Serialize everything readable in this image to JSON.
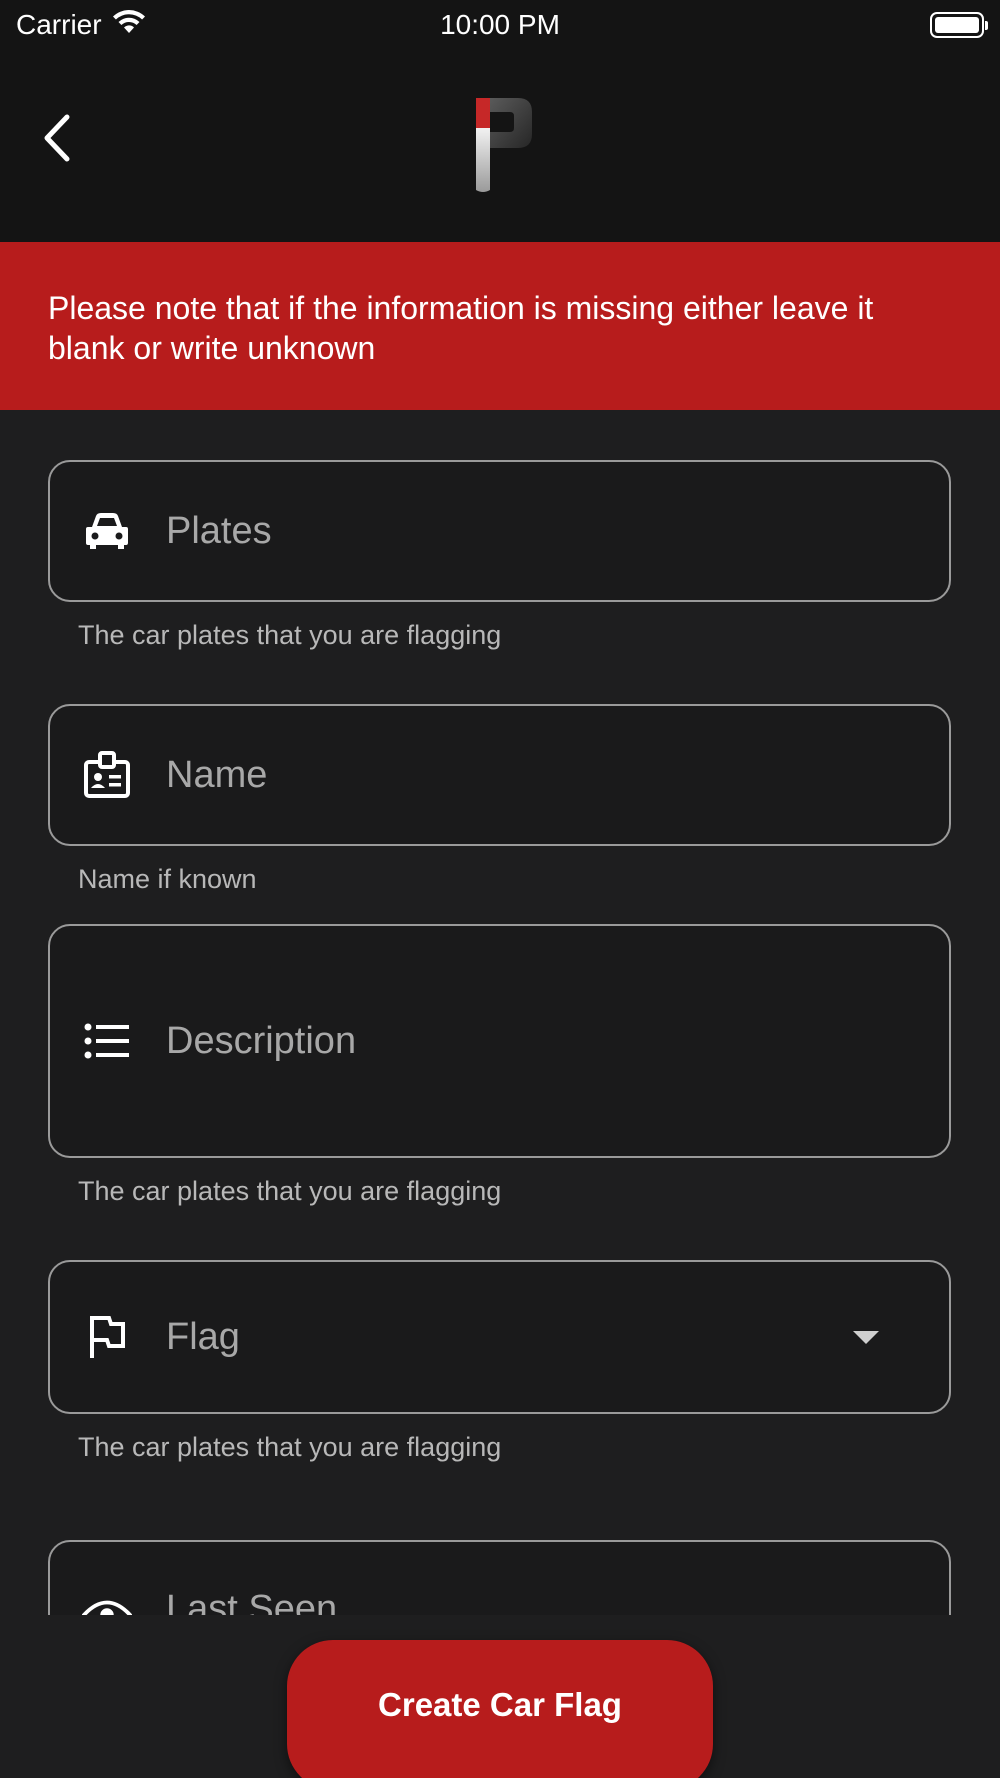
{
  "status_bar": {
    "carrier": "Carrier",
    "time": "10:00 PM"
  },
  "notice": {
    "text": "Please note that if the information is missing either leave it blank or write unknown"
  },
  "fields": {
    "plates": {
      "placeholder": "Plates",
      "helper": "The car plates that you are flagging",
      "icon": "car-icon"
    },
    "name": {
      "placeholder": "Name",
      "helper": "Name if known",
      "icon": "id-badge-icon"
    },
    "description": {
      "placeholder": "Description",
      "helper": "The car plates that you are flagging",
      "icon": "list-icon"
    },
    "flag": {
      "placeholder": "Flag",
      "helper": "The car plates that you are flagging",
      "icon": "flag-icon"
    },
    "last_seen": {
      "placeholder": "Last Seen",
      "icon": "eye-icon"
    }
  },
  "cta": {
    "label": "Create Car Flag"
  },
  "colors": {
    "accent": "#b71c1c",
    "background": "#1e1e1f",
    "app_bar": "#141414"
  }
}
